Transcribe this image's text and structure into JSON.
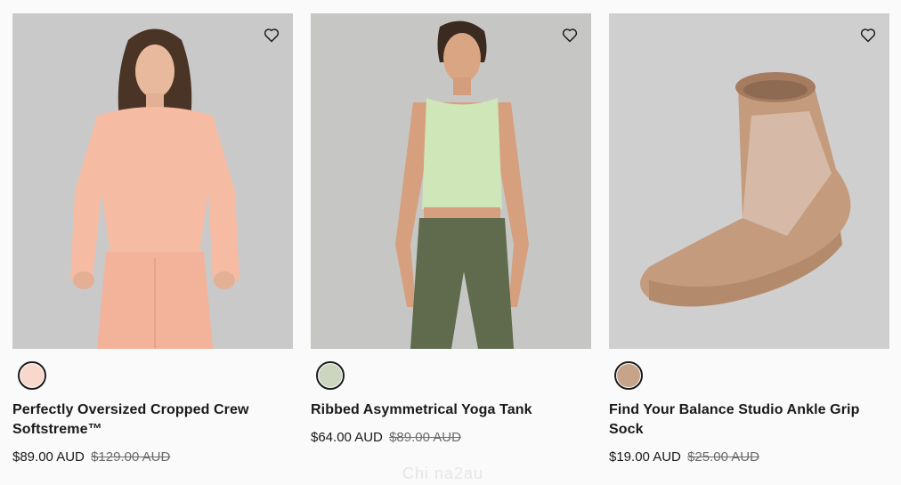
{
  "products": [
    {
      "title": "Perfectly Oversized Cropped Crew Softstreme™",
      "price": "$89.00 AUD",
      "old_price": "$129.00 AUD",
      "swatch_color": "#f8d7cc",
      "image_bg": "#c9c9c9"
    },
    {
      "title": "Ribbed Asymmetrical Yoga Tank",
      "price": "$64.00 AUD",
      "old_price": "$89.00 AUD",
      "swatch_color": "#ccd6bf",
      "image_bg": "#c6c7c5"
    },
    {
      "title": "Find Your Balance Studio Ankle Grip Sock",
      "price": "$19.00 AUD",
      "old_price": "$25.00 AUD",
      "swatch_color": "#c7a38a",
      "image_bg": "#cfcfcf"
    }
  ],
  "icons": {
    "wishlist": "heart-outline-icon"
  },
  "watermark": "Chi na2au"
}
